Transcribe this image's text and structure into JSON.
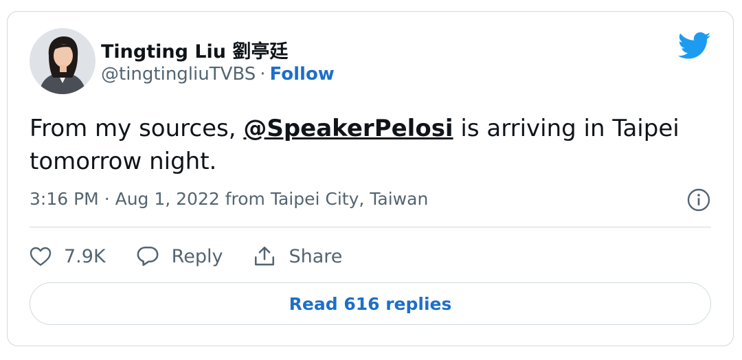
{
  "author": {
    "name": "Tingting Liu 劉亭廷",
    "handle": "@tingtingliuTVBS",
    "separator": "·",
    "follow_label": "Follow"
  },
  "tweet": {
    "text_before": "From my sources, ",
    "mention": "@SpeakerPelosi",
    "text_after": " is arriving in Taipei tomorrow night."
  },
  "meta": {
    "time": "3:16 PM",
    "separator": "·",
    "date_location": "Aug 1, 2022 from Taipei City, Taiwan"
  },
  "actions": {
    "like_count": "7.9K",
    "reply_label": "Reply",
    "share_label": "Share"
  },
  "read_replies_label": "Read 616 replies",
  "colors": {
    "link_blue": "#1d6fc9",
    "twitter_blue": "#1d9bf0",
    "text_primary": "#0f1419",
    "text_secondary": "#536471",
    "border": "#cfd9de"
  },
  "icons": {
    "logo": "twitter-bird-icon",
    "info": "info-icon",
    "like": "heart-icon",
    "reply": "speech-bubble-icon",
    "share": "share-upload-icon"
  }
}
